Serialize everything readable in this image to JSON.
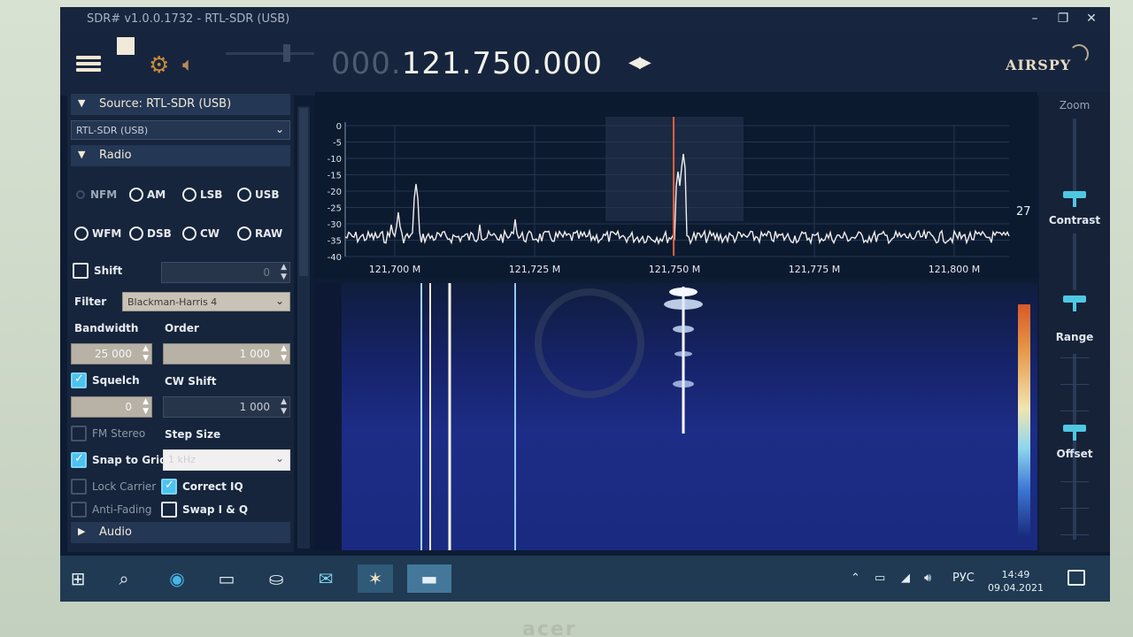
{
  "window": {
    "title": "SDR# v1.0.0.1732 - RTL-SDR (USB)"
  },
  "toolbar": {
    "frequency_dim": "000.",
    "frequency_main": "121.750.000",
    "logo": "AIRSPY"
  },
  "source": {
    "header": "Source: RTL-SDR (USB)",
    "device": "RTL-SDR (USB)"
  },
  "radio": {
    "header": "Radio",
    "modes": [
      "NFM",
      "AM",
      "LSB",
      "USB",
      "WFM",
      "DSB",
      "CW",
      "RAW"
    ],
    "shift_label": "Shift",
    "shift_value": "0",
    "filter_label": "Filter",
    "filter_value": "Blackman-Harris 4",
    "bandwidth_label": "Bandwidth",
    "bandwidth_value": "25 000",
    "order_label": "Order",
    "order_value": "1 000",
    "squelch_label": "Squelch",
    "squelch_value": "0",
    "cwshift_label": "CW Shift",
    "cwshift_value": "1 000",
    "fm_stereo_label": "FM Stereo",
    "step_size_label": "Step Size",
    "snap_label": "Snap to Grid",
    "step_value": "1 kHz",
    "lock_carrier_label": "Lock Carrier",
    "correct_iq_label": "Correct IQ",
    "anti_fading_label": "Anti-Fading",
    "swap_iq_label": "Swap I & Q"
  },
  "audio": {
    "header": "Audio"
  },
  "spectrum": {
    "db_ticks": [
      "0",
      "-5",
      "-10",
      "-15",
      "-20",
      "-25",
      "-30",
      "-35",
      "-40"
    ],
    "freq_ticks": [
      "121,700 M",
      "121,725 M",
      "121,750 M",
      "121,775 M",
      "121,800 M"
    ],
    "level_readout": "27"
  },
  "side_controls": {
    "zoom": "Zoom",
    "contrast": "Contrast",
    "range": "Range",
    "offset": "Offset"
  },
  "taskbar": {
    "lang": "РУС",
    "time": "14:49",
    "date": "09.04.2021"
  },
  "bezel": {
    "brand": "acer"
  }
}
